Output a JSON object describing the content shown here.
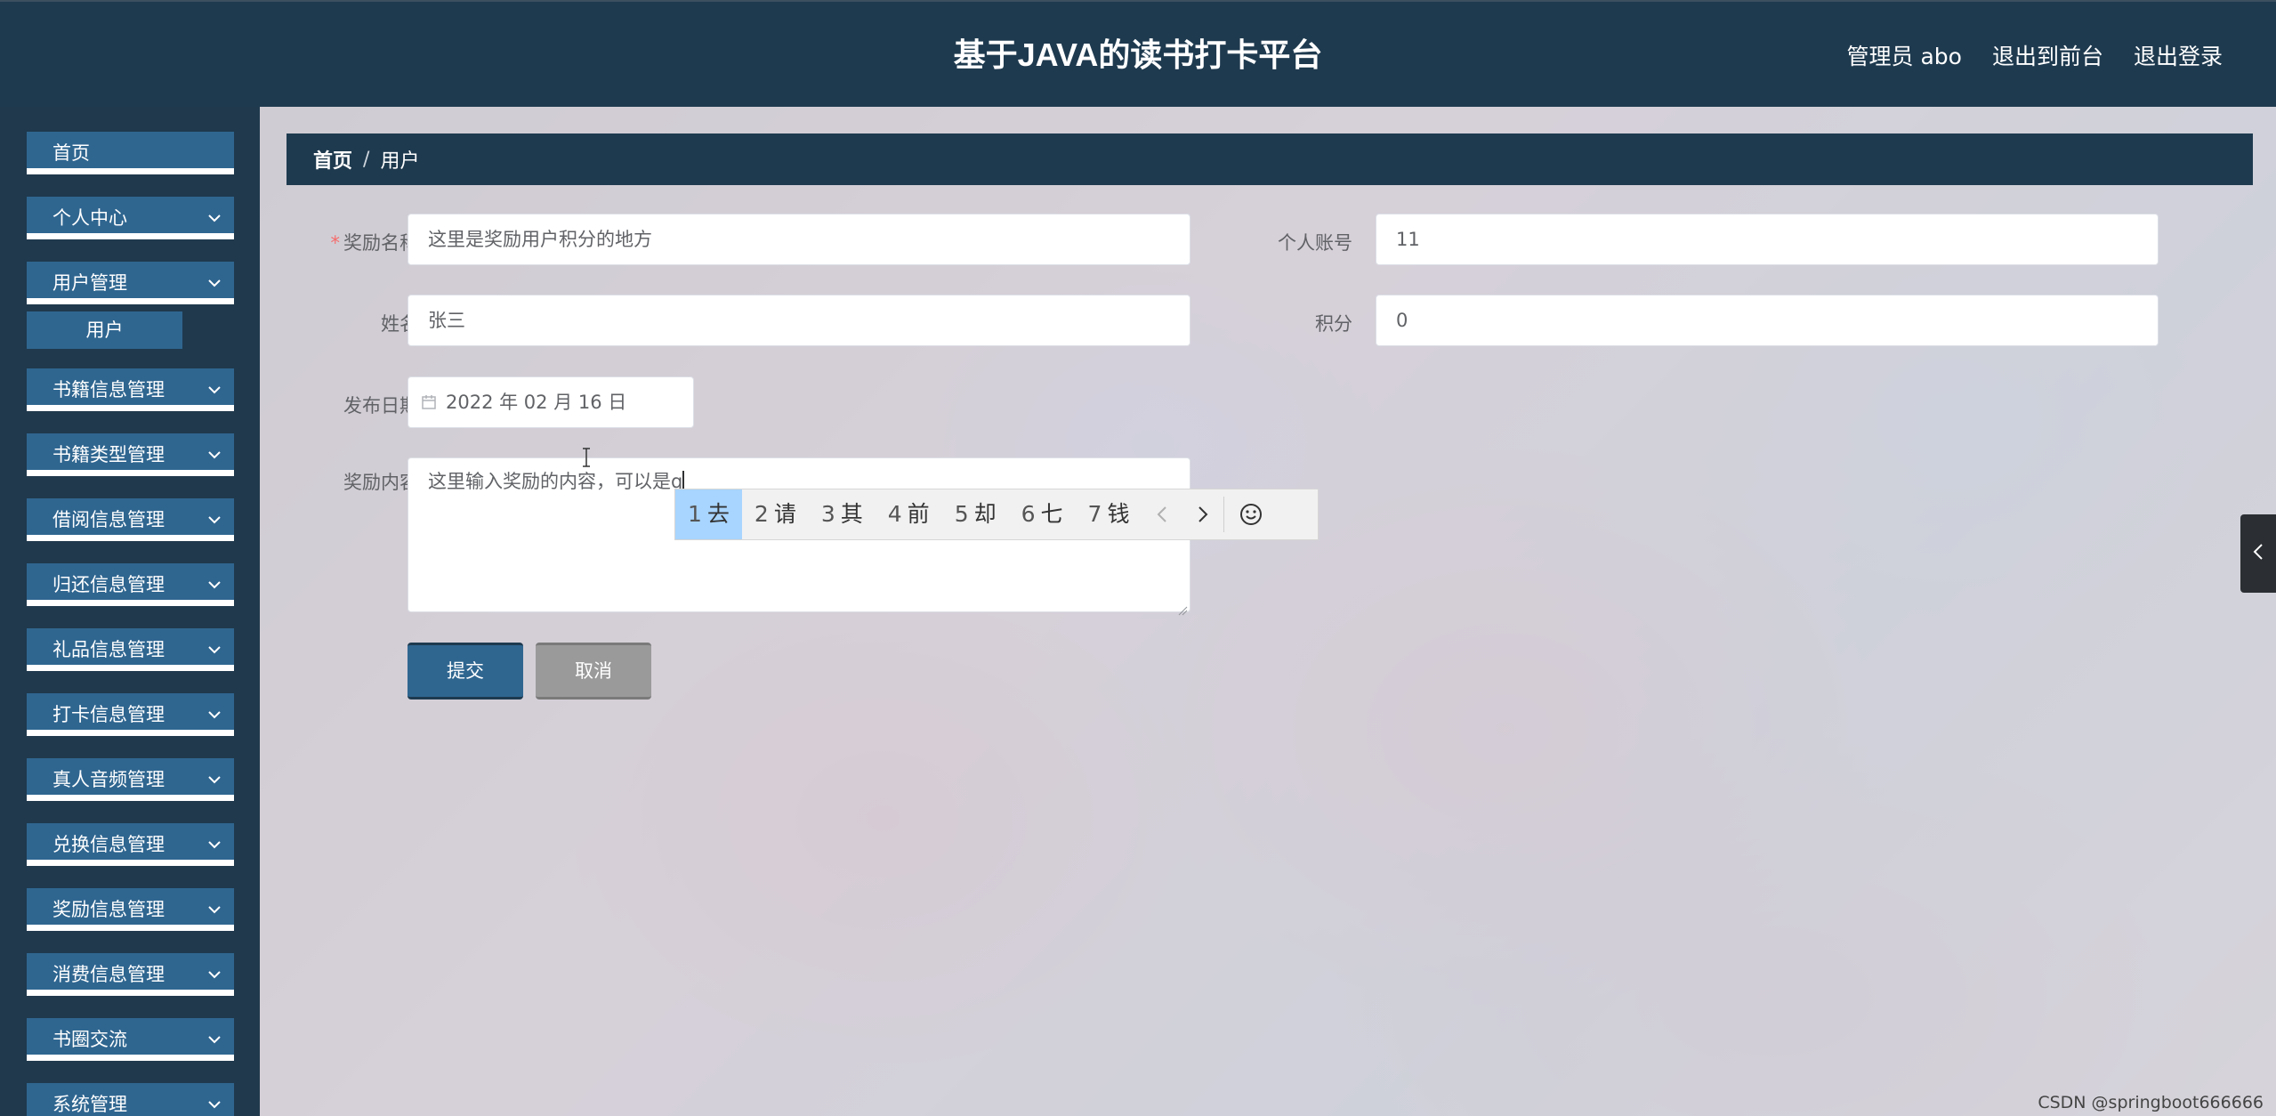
{
  "header": {
    "title": "基于JAVA的读书打卡平台",
    "admin_label": "管理员 abo",
    "back_front": "退出到前台",
    "logout": "退出登录"
  },
  "sidebar": {
    "items": [
      {
        "label": "首页"
      },
      {
        "label": "个人中心"
      },
      {
        "label": "用户管理",
        "sub": "用户"
      },
      {
        "label": "书籍信息管理"
      },
      {
        "label": "书籍类型管理"
      },
      {
        "label": "借阅信息管理"
      },
      {
        "label": "归还信息管理"
      },
      {
        "label": "礼品信息管理"
      },
      {
        "label": "打卡信息管理"
      },
      {
        "label": "真人音频管理"
      },
      {
        "label": "兑换信息管理"
      },
      {
        "label": "奖励信息管理"
      },
      {
        "label": "消费信息管理"
      },
      {
        "label": "书圈交流"
      },
      {
        "label": "系统管理"
      }
    ]
  },
  "breadcrumb": {
    "home": "首页",
    "separator": "/",
    "current": "用户"
  },
  "form": {
    "reward_name": {
      "label": "奖励名称",
      "required_mark": "*",
      "value": "这里是奖励用户积分的地方"
    },
    "account": {
      "label": "个人账号",
      "value": "11"
    },
    "name": {
      "label": "姓名",
      "value": "张三"
    },
    "points": {
      "label": "积分",
      "value": "0"
    },
    "publish_date": {
      "label": "发布日期",
      "value": "2022 年 02 月 16 日"
    },
    "reward_content": {
      "label": "奖励内容",
      "value": "这里输入奖励的内容，可以是",
      "composing": "q"
    },
    "submit": "提交",
    "cancel": "取消"
  },
  "ime": {
    "candidates": [
      {
        "num": "1",
        "char": "去"
      },
      {
        "num": "2",
        "char": "请"
      },
      {
        "num": "3",
        "char": "其"
      },
      {
        "num": "4",
        "char": "前"
      },
      {
        "num": "5",
        "char": "却"
      },
      {
        "num": "6",
        "char": "七"
      },
      {
        "num": "7",
        "char": "钱"
      }
    ]
  },
  "watermark": "CSDN @springboot666666",
  "colors": {
    "header_bg": "#1e3a4f",
    "menu_bg": "#2f6690",
    "ime_active": "#a8d5ff",
    "cancel_bg": "#9a9a9a"
  }
}
